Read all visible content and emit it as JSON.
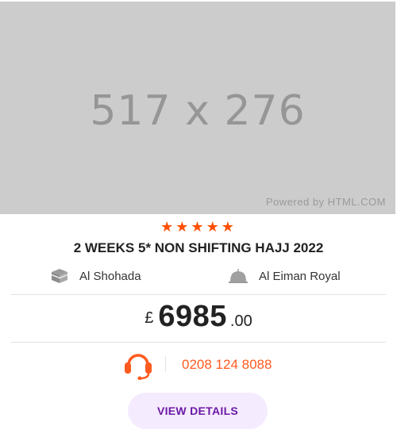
{
  "image": {
    "placeholder_text": "517 x 276",
    "powered_by": "Powered by HTML.COM"
  },
  "rating": {
    "stars": 5,
    "color": "#ff4f00"
  },
  "package": {
    "title": "2 WEEKS 5* NON SHIFTING HAJJ 2022"
  },
  "hotels": [
    {
      "name": "Al Shohada",
      "icon": "kaaba-icon"
    },
    {
      "name": "Al Eiman Royal",
      "icon": "mosque-dome-icon"
    }
  ],
  "price": {
    "currency": "£",
    "amount": "6985",
    "decimals": ".00"
  },
  "contact": {
    "phone": "0208 124 8088",
    "icon": "headset-icon"
  },
  "button": {
    "label": "VIEW DETAILS"
  },
  "colors": {
    "accent": "#ff5a1f",
    "button_bg": "#f5ebfe",
    "button_text": "#6b1aa6"
  }
}
